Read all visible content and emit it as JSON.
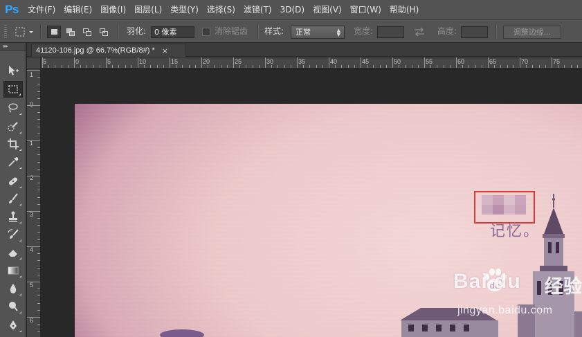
{
  "app": {
    "logo": "Ps"
  },
  "menu": [
    "文件(F)",
    "编辑(E)",
    "图像(I)",
    "图层(L)",
    "类型(Y)",
    "选择(S)",
    "滤镜(T)",
    "3D(D)",
    "视图(V)",
    "窗口(W)",
    "帮助(H)"
  ],
  "options": {
    "feather_label": "羽化:",
    "feather_value": "0 像素",
    "antialias_label": "消除锯齿",
    "style_label": "样式:",
    "style_value": "正常",
    "width_label": "宽度:",
    "height_label": "高度:",
    "refine_edge_button": "调整边缘..."
  },
  "document": {
    "tab_title": "41120-106.jpg @ 66.7%(RGB/8#) *",
    "close_glyph": "×"
  },
  "ruler": {
    "top_labels": [
      "5",
      "0",
      "5",
      "10",
      "15",
      "20",
      "25",
      "30",
      "35",
      "40",
      "45",
      "50",
      "55",
      "60",
      "65",
      "70",
      "75"
    ],
    "left_labels": [
      "1",
      "0",
      "1",
      "2",
      "3",
      "4",
      "5",
      "6"
    ]
  },
  "canvas": {
    "text": "记忆。",
    "watermark_brand": "Bai  du",
    "watermark_cn": "经验",
    "watermark_url": "jingyan.baidu.com"
  },
  "colors": {
    "ui_panel": "#535353",
    "workspace": "#282828",
    "selection_highlight": "#e03737",
    "ps_logo": "#31a8ff"
  },
  "tools": [
    "move-tool",
    "rectangular-marquee-tool",
    "lasso-tool",
    "quick-selection-tool",
    "crop-tool",
    "eyedropper-tool",
    "spot-healing-tool",
    "brush-tool",
    "clone-stamp-tool",
    "history-brush-tool",
    "eraser-tool",
    "gradient-tool",
    "blur-tool",
    "dodge-tool",
    "pen-tool"
  ]
}
